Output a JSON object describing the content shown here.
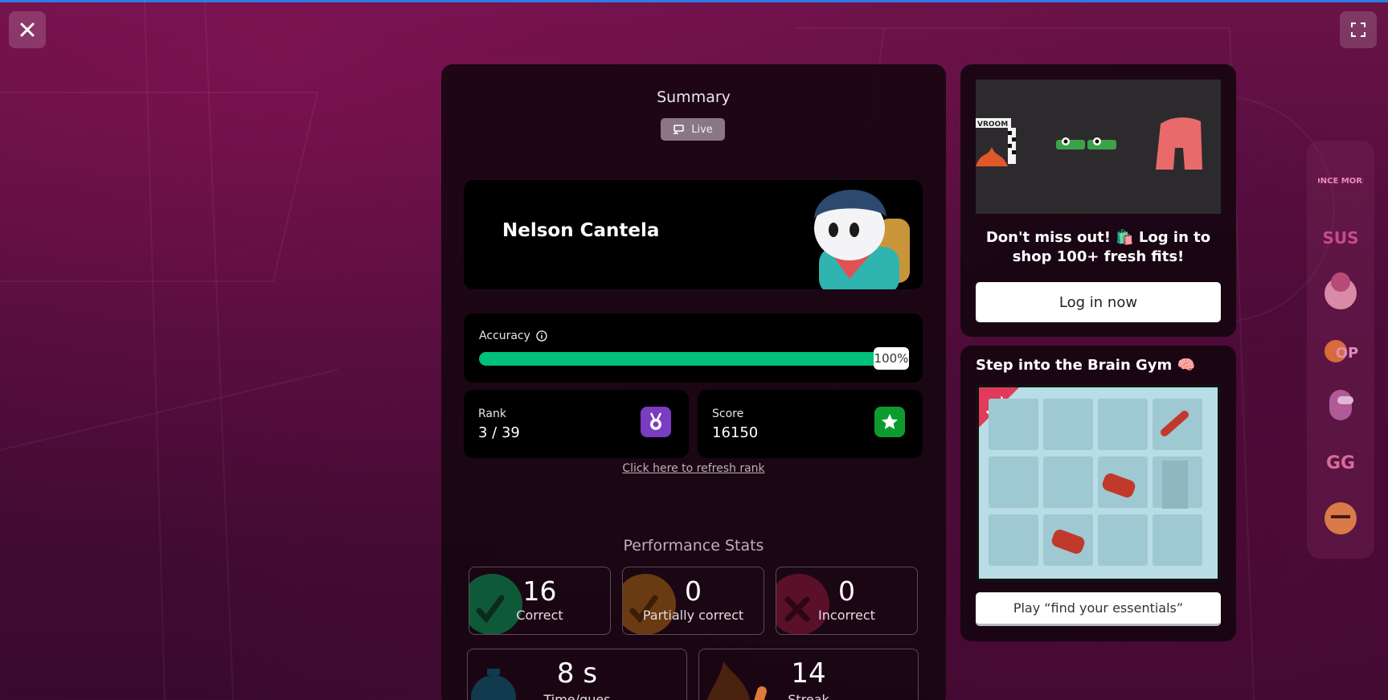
{
  "summary": {
    "title": "Summary",
    "live_label": "Live"
  },
  "player": {
    "name": "Nelson Cantela"
  },
  "accuracy": {
    "label": "Accuracy",
    "value_percent": 100,
    "value_label": "100%"
  },
  "rank": {
    "label": "Rank",
    "value": "3 / 39"
  },
  "score": {
    "label": "Score",
    "value": "16150"
  },
  "refresh_link": "Click here to refresh rank",
  "performance": {
    "title": "Performance Stats",
    "stats": [
      {
        "value": "16",
        "label": "Correct"
      },
      {
        "value": "0",
        "label": "Partially correct"
      },
      {
        "value": "0",
        "label": "Incorrect"
      },
      {
        "value": "8 s",
        "label": "Time/ques"
      },
      {
        "value": "14",
        "label": "Streak"
      }
    ]
  },
  "ad": {
    "banner_text": "VROOM",
    "promo_text": "Don't miss out! 🛍️ Log in to shop 100+ fresh fits!",
    "login_button": "Log in now"
  },
  "brain_gym": {
    "title": "Step into the Brain Gym 🧠",
    "new_badge": "NEW",
    "play_button": "Play “find your essentials”"
  },
  "sidebar": {
    "items": [
      "once-more-sticker",
      "sus-sticker",
      "character-sticker",
      "op-sticker",
      "crewmate-sticker",
      "gg-sticker",
      "character-face-sticker"
    ],
    "once_more_text": "ONCE MORE",
    "sus_text": "SUS",
    "op_text": "OP",
    "gg_text": "GG"
  },
  "colors": {
    "accent_blue": "#2f7be0",
    "accuracy_green": "#00c07c",
    "rank_badge": "#7a3cc0",
    "score_badge": "#0d9b2e",
    "background": "#5a0f40"
  },
  "icons": {
    "close": "close-icon",
    "fullscreen": "fullscreen-icon",
    "live": "live-icon",
    "info": "info-icon",
    "medal": "medal-icon",
    "star": "star-icon",
    "check": "check-icon",
    "cross": "cross-icon",
    "stopwatch": "stopwatch-icon",
    "fire": "fire-icon"
  }
}
